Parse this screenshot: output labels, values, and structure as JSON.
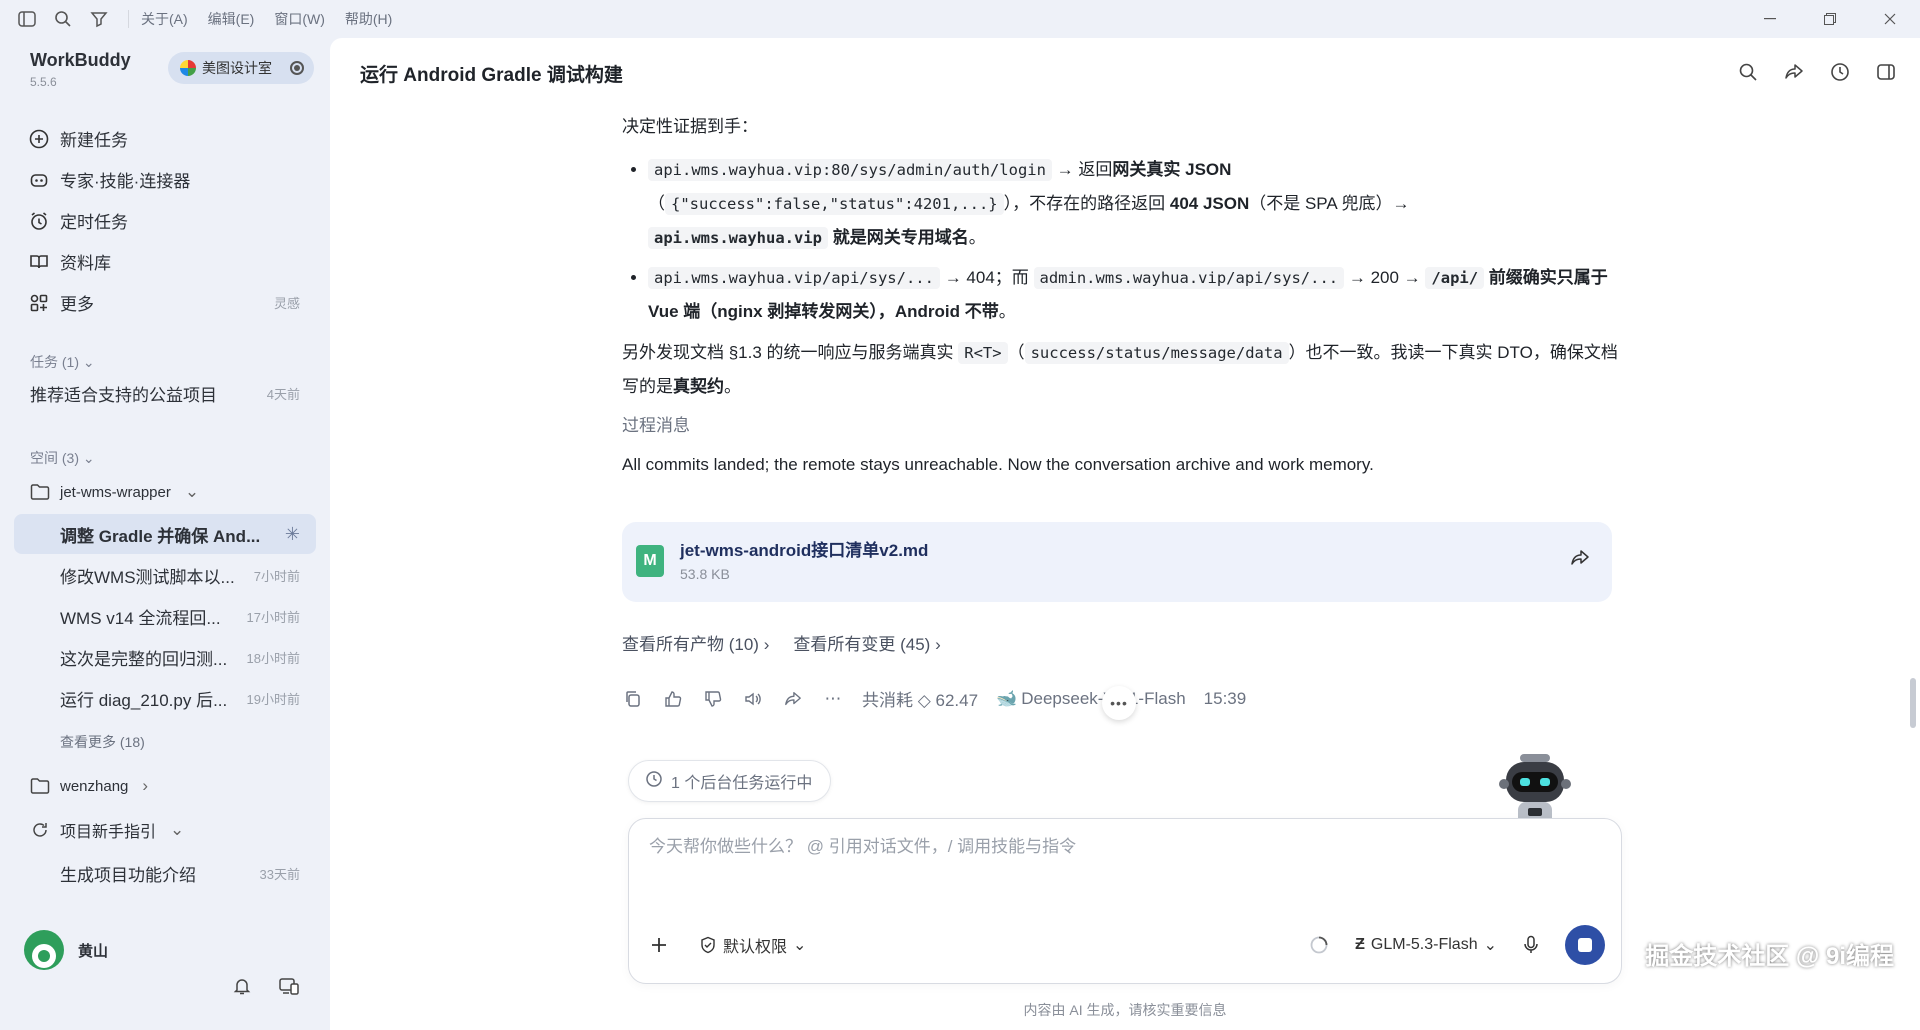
{
  "titlebar": {
    "menus": [
      "关于(A)",
      "编辑(E)",
      "窗口(W)",
      "帮助(H)"
    ]
  },
  "brand": {
    "name": "WorkBuddy",
    "version": "5.5.6"
  },
  "workspace": {
    "label": "美图设计室"
  },
  "nav": [
    {
      "label": "新建任务",
      "icon": "plus-circle-icon"
    },
    {
      "label": "专家·技能·连接器",
      "icon": "bot-icon"
    },
    {
      "label": "定时任务",
      "icon": "alarm-icon"
    },
    {
      "label": "资料库",
      "icon": "book-icon"
    },
    {
      "label": "更多",
      "icon": "grid-icon",
      "hint": "灵感"
    }
  ],
  "tasks_section": {
    "label": "任务 (1)",
    "items": [
      {
        "title": "推荐适合支持的公益项目",
        "time": "4天前"
      }
    ]
  },
  "spaces_section": {
    "label": "空间 (3)",
    "spaces": [
      {
        "name": "jet-wms-wrapper",
        "items": [
          {
            "title": "调整 Gradle 并确保 And...",
            "time": ""
          },
          {
            "title": "修改WMS测试脚本以...",
            "time": "7小时前"
          },
          {
            "title": "WMS v14 全流程回...",
            "time": "17小时前"
          },
          {
            "title": "这次是完整的回归测...",
            "time": "18小时前"
          },
          {
            "title": "运行 diag_210.py 后...",
            "time": "19小时前"
          }
        ],
        "more": "查看更多 (18)"
      },
      {
        "name": "wenzhang"
      },
      {
        "name": "项目新手指引",
        "items": [
          {
            "title": "生成项目功能介绍",
            "time": "33天前"
          }
        ]
      }
    ]
  },
  "user": {
    "name": "黄山"
  },
  "main": {
    "title": "运行 Android Gradle 调试构建",
    "intro": "决定性证据到手：",
    "bullet1": {
      "code1": "api.wms.wayhua.vip:80/sys/admin/auth/login",
      "t1": " → 返回",
      "b1": "网关真实 JSON",
      "t2": "（",
      "code2": "{\"success\":false,\"status\":4201,...}",
      "t3": "），不存在的路径返回 ",
      "b2": "404 JSON",
      "t4": "（不是 SPA 兜底）→",
      "code3": "api.wms.wayhua.vip",
      "b3": " 就是网关专用域名",
      "t5": "。"
    },
    "bullet2": {
      "code1": "api.wms.wayhua.vip/api/sys/...",
      "t1": " → 404；而 ",
      "code2": "admin.wms.wayhua.vip/api/sys/...",
      "t2": " → 200 → ",
      "code3": "/api/",
      "b1": " 前缀确实只属于 Vue 端（nginx 剥掉转发网关），Android 不带",
      "t3": "。"
    },
    "para2": {
      "t1": "另外发现文档 §1.3 的统一响应与服务端真实 ",
      "code1": "R<T>",
      "t2": "（",
      "code2": "success/status/message/data",
      "t3": "）也不一致。我读一下真实 DTO，确保文档写的是",
      "b1": "真契约",
      "t4": "。"
    },
    "process_label": "过程消息",
    "english_line": "All commits landed; the remote stays unreachable. Now the conversation archive and work memory.",
    "file": {
      "name": "jet-wms-android接口清单v2.md",
      "size": "53.8 KB",
      "badge": "M"
    },
    "links": {
      "artifacts": "查看所有产物 (10)",
      "changes": "查看所有变更 (45)"
    },
    "meta": {
      "cost": "共消耗 ◇ 62.47",
      "model": "Deepseek-V4.1-Flash",
      "time": "15:39"
    },
    "bg_task": "1 个后台任务运行中",
    "composer": {
      "placeholder": "今天帮你做些什么？ @ 引用对话文件，/ 调用技能与指令",
      "permission": "默认权限",
      "model": "GLM-5.3-Flash"
    },
    "disclaimer": "内容由 AI 生成，请核实重要信息",
    "watermark": "掘金技术社区 @ 9i编程"
  }
}
